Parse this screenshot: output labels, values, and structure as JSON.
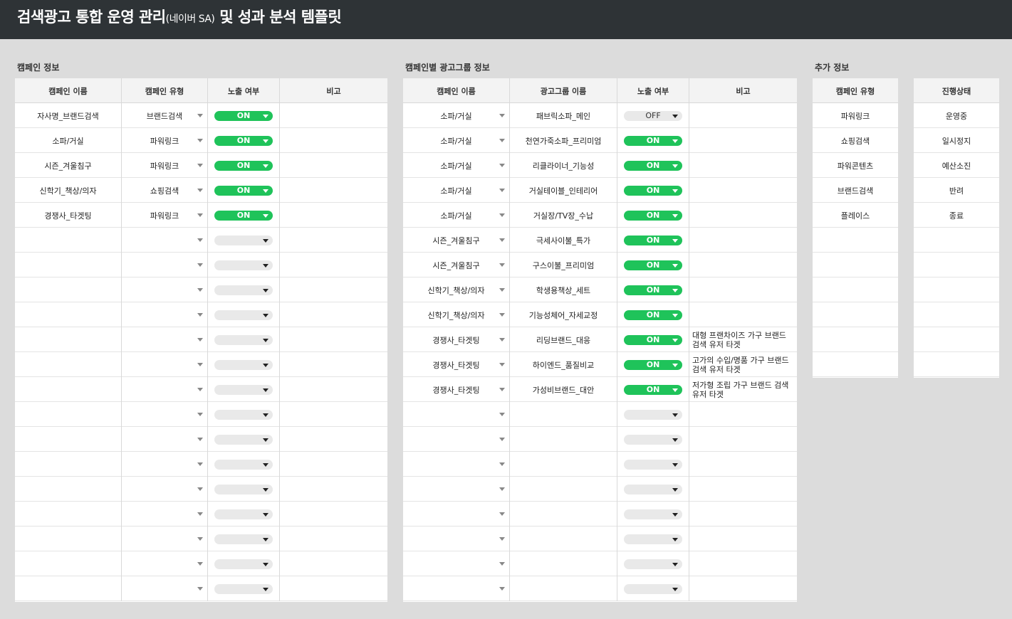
{
  "header": {
    "title_main": "검색광고 통합 운영 관리",
    "title_small": "(네이버 SA)",
    "title_tail": " 및 성과 분석 템플릿"
  },
  "colors": {
    "on": "#1fc35a",
    "header_bg": "#2e3336"
  },
  "campaign_info": {
    "label": "캠페인 정보",
    "columns": [
      "캠페인 이름",
      "캠페인 유형",
      "노출 여부",
      "비고"
    ],
    "rows": [
      {
        "name": "자사명_브랜드검색",
        "type": "브랜드검색",
        "status": "ON",
        "note": ""
      },
      {
        "name": "소파/거실",
        "type": "파워링크",
        "status": "ON",
        "note": ""
      },
      {
        "name": "시즌_겨울침구",
        "type": "파워링크",
        "status": "ON",
        "note": ""
      },
      {
        "name": "신학기_책상/의자",
        "type": "쇼핑검색",
        "status": "ON",
        "note": ""
      },
      {
        "name": "경쟁사_타겟팅",
        "type": "파워링크",
        "status": "ON",
        "note": ""
      },
      {
        "name": "",
        "type": "",
        "status": "",
        "note": ""
      },
      {
        "name": "",
        "type": "",
        "status": "",
        "note": ""
      },
      {
        "name": "",
        "type": "",
        "status": "",
        "note": ""
      },
      {
        "name": "",
        "type": "",
        "status": "",
        "note": ""
      },
      {
        "name": "",
        "type": "",
        "status": "",
        "note": ""
      },
      {
        "name": "",
        "type": "",
        "status": "",
        "note": ""
      },
      {
        "name": "",
        "type": "",
        "status": "",
        "note": ""
      },
      {
        "name": "",
        "type": "",
        "status": "",
        "note": ""
      },
      {
        "name": "",
        "type": "",
        "status": "",
        "note": ""
      },
      {
        "name": "",
        "type": "",
        "status": "",
        "note": ""
      },
      {
        "name": "",
        "type": "",
        "status": "",
        "note": ""
      },
      {
        "name": "",
        "type": "",
        "status": "",
        "note": ""
      },
      {
        "name": "",
        "type": "",
        "status": "",
        "note": ""
      },
      {
        "name": "",
        "type": "",
        "status": "",
        "note": ""
      },
      {
        "name": "",
        "type": "",
        "status": "",
        "note": ""
      }
    ]
  },
  "adgroup_info": {
    "label": "캠페인별 광고그룹 정보",
    "columns": [
      "캠페인 이름",
      "광고그룹 이름",
      "노출 여부",
      "비고"
    ],
    "rows": [
      {
        "campaign": "소파/거실",
        "group": "패브릭소파_메인",
        "status": "OFF",
        "note": ""
      },
      {
        "campaign": "소파/거실",
        "group": "천연가죽소파_프리미엄",
        "status": "ON",
        "note": ""
      },
      {
        "campaign": "소파/거실",
        "group": "리클라이너_기능성",
        "status": "ON",
        "note": ""
      },
      {
        "campaign": "소파/거실",
        "group": "거실테이블_인테리어",
        "status": "ON",
        "note": ""
      },
      {
        "campaign": "소파/거실",
        "group": "거실장/TV장_수납",
        "status": "ON",
        "note": ""
      },
      {
        "campaign": "시즌_겨울침구",
        "group": "극세사이불_특가",
        "status": "ON",
        "note": ""
      },
      {
        "campaign": "시즌_겨울침구",
        "group": "구스이불_프리미엄",
        "status": "ON",
        "note": ""
      },
      {
        "campaign": "신학기_책상/의자",
        "group": "학생용책상_세트",
        "status": "ON",
        "note": ""
      },
      {
        "campaign": "신학기_책상/의자",
        "group": "기능성체어_자세교정",
        "status": "ON",
        "note": ""
      },
      {
        "campaign": "경쟁사_타겟팅",
        "group": "리딩브랜드_대응",
        "status": "ON",
        "note": "대형 프랜차이즈 가구 브랜드 검색 유저 타겟"
      },
      {
        "campaign": "경쟁사_타겟팅",
        "group": "하이엔드_품질비교",
        "status": "ON",
        "note": "고가의 수입/명품 가구 브랜드 검색 유저 타겟"
      },
      {
        "campaign": "경쟁사_타겟팅",
        "group": "가성비브랜드_대안",
        "status": "ON",
        "note": "저가형 조립 가구 브랜드 검색 유저 타겟"
      },
      {
        "campaign": "",
        "group": "",
        "status": "",
        "note": ""
      },
      {
        "campaign": "",
        "group": "",
        "status": "",
        "note": ""
      },
      {
        "campaign": "",
        "group": "",
        "status": "",
        "note": ""
      },
      {
        "campaign": "",
        "group": "",
        "status": "",
        "note": ""
      },
      {
        "campaign": "",
        "group": "",
        "status": "",
        "note": ""
      },
      {
        "campaign": "",
        "group": "",
        "status": "",
        "note": ""
      },
      {
        "campaign": "",
        "group": "",
        "status": "",
        "note": ""
      },
      {
        "campaign": "",
        "group": "",
        "status": "",
        "note": ""
      }
    ]
  },
  "extra_info": {
    "label": "추가 정보",
    "type_header": "캠페인 유형",
    "types": [
      "파워링크",
      "쇼핑검색",
      "파워콘텐츠",
      "브랜드검색",
      "플레이스",
      "",
      "",
      "",
      "",
      "",
      ""
    ],
    "status_header": "진행상태",
    "statuses": [
      "운영중",
      "일시정지",
      "예산소진",
      "반려",
      "종료",
      "",
      "",
      "",
      "",
      "",
      ""
    ]
  }
}
